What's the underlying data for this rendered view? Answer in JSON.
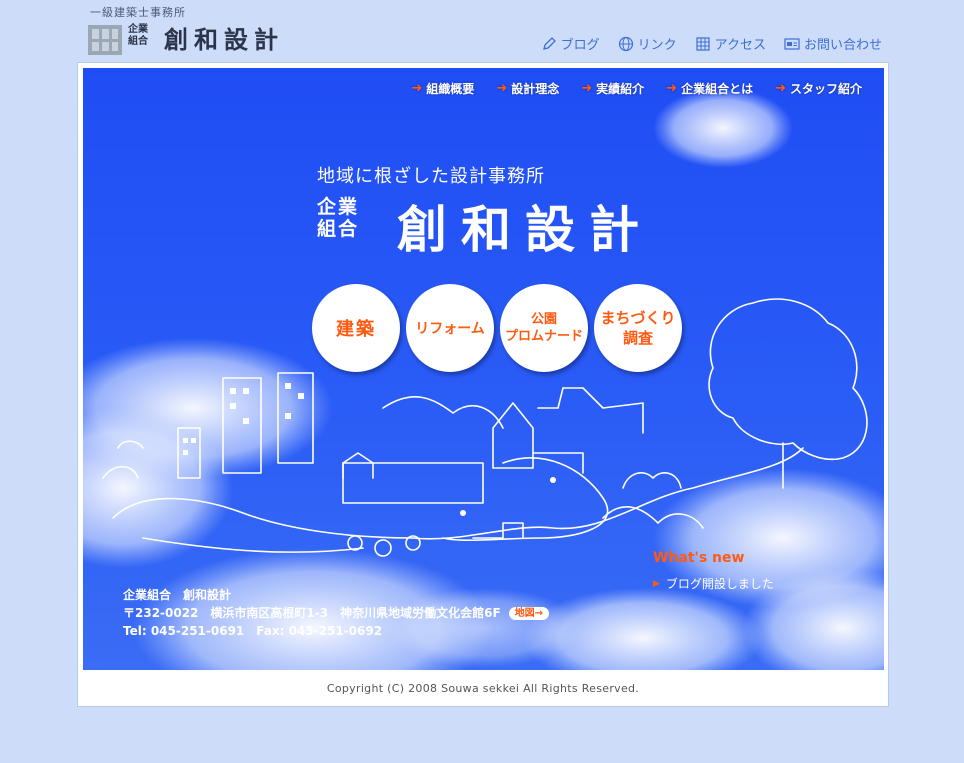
{
  "logo": {
    "subtitle": "一級建築士事務所",
    "kigyo": "企業組合",
    "name": "創和設計"
  },
  "topnav": [
    {
      "label": "ブログ",
      "icon": "pencil-icon"
    },
    {
      "label": "リンク",
      "icon": "globe-icon"
    },
    {
      "label": "アクセス",
      "icon": "grid-map-icon"
    },
    {
      "label": "お問い合わせ",
      "icon": "contact-card-icon"
    }
  ],
  "mainnav": [
    {
      "label": "組織概要"
    },
    {
      "label": "設計理念"
    },
    {
      "label": "実績紹介"
    },
    {
      "label": "企業組合とは"
    },
    {
      "label": "スタッフ紹介"
    }
  ],
  "hero": {
    "tagline": "地域に根ざした設計事務所",
    "kigyo": "企業組合",
    "name": "創和設計"
  },
  "services": [
    {
      "label": "建築"
    },
    {
      "label": "リフォーム"
    },
    {
      "label_line1": "公園",
      "label_line2": "プロムナード"
    },
    {
      "label_line1": "まちづくり",
      "label_line2": "調査"
    }
  ],
  "news": {
    "heading": "What's new",
    "items": [
      "ブログ開設しました"
    ]
  },
  "address": {
    "company": "企業組合　創和設計",
    "postal_address": "〒232-0022　横浜市南区高根町1-3　神奈川県地域労働文化会館6F",
    "map_label": "地図→",
    "contact": "Tel: 045-251-0691　Fax: 045-251-0692"
  },
  "footer": {
    "copyright": "Copyright (C) 2008 Souwa sekkei All Rights Reserved."
  },
  "colors": {
    "page_bg": "#cddcf9",
    "hero_blue": "#2656f5",
    "accent_orange": "#ff5a12",
    "link_blue": "#3d6fd3"
  }
}
